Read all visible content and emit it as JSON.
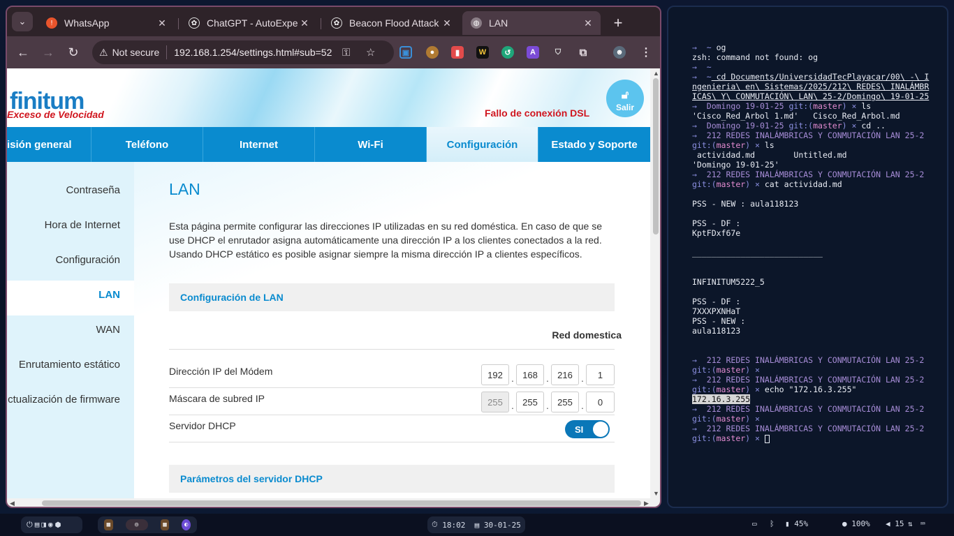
{
  "browser": {
    "tabs": [
      {
        "title": "WhatsApp",
        "icon": "whatsapp-icon",
        "active": false
      },
      {
        "title": "ChatGPT - AutoExpert",
        "icon": "chatgpt-icon",
        "active": false
      },
      {
        "title": "Beacon Flood Attack",
        "icon": "chatgpt-icon",
        "active": false
      },
      {
        "title": "LAN",
        "icon": "globe-icon",
        "active": true
      }
    ],
    "security_label": "Not secure",
    "url": "192.168.1.254/settings.html#sub=52"
  },
  "page": {
    "brand": "finitum",
    "tagline": "Exceso de Velocidad",
    "dsl_status": "Fallo de conexión DSL",
    "logout_label": "Salir",
    "main_tabs": [
      "isión general",
      "Teléfono",
      "Internet",
      "Wi-Fi",
      "Configuración",
      "Estado y Soporte"
    ],
    "active_main_tab": "Configuración",
    "sidebar": [
      "Contraseña",
      "Hora de Internet",
      "Configuración",
      "LAN",
      "WAN",
      "Enrutamiento estático",
      "ctualización de firmware"
    ],
    "active_sidebar": "LAN",
    "title": "LAN",
    "description": "Esta página permite configurar las direcciones IP utilizadas en su red doméstica. En caso de que se use DHCP el enrutador asigna automáticamente una dirección IP a los clientes conectados a la red. Usando DHCP estático es posible asignar siempre la misma dirección IP a clientes específicos.",
    "section_lan": "Configuración de LAN",
    "column_header": "Red domestica",
    "modem_ip_label": "Dirección IP del Módem",
    "modem_ip": [
      "192",
      "168",
      "216",
      "1"
    ],
    "subnet_label": "Máscara de subred IP",
    "subnet": [
      "255",
      "255",
      "255",
      "0"
    ],
    "dhcp_label": "Servidor DHCP",
    "dhcp_toggle": "SI",
    "section_dhcp": "Parámetros del servidor DHCP"
  },
  "terminal": {
    "lines": [
      "→  ~ og",
      "zsh: command not found: og",
      "→  ~",
      "→  ~ cd Documents/UniversidadTecPlayacar/00\\ -\\ Ingenieria\\ en\\ Sistemas/2025/212\\ REDES\\ INALÁMBRICAS\\ Y\\ CONMUTACIÓN\\ LAN\\ 25-2/Domingo\\ 19-01-25",
      "→  Domingo 19-01-25 git:(master) × ls",
      "'Cisco_Red_Arbol 1.md'   Cisco_Red_Arbol.md",
      "→  Domingo 19-01-25 git:(master) × cd ..",
      "→  212 REDES INALÁMBRICAS Y CONMUTACIÓN LAN 25-2 git:(master) × ls",
      " actividad.md        Untitled.md",
      "'Domingo 19-01-25'",
      "→  212 REDES INALÁMBRICAS Y CONMUTACIÓN LAN 25-2 git:(master) × cat actividad.md",
      "",
      "PSS - NEW : aula118123",
      "",
      "PSS - DF :",
      "KptFDxf67e",
      "",
      "___________________________",
      "",
      "",
      "INFINITUM5222_5",
      "",
      "PSS - DF :",
      "7XXXPXNHaT",
      "PSS - NEW :",
      "aula118123",
      "",
      "",
      "→  212 REDES INALÁMBRICAS Y CONMUTACIÓN LAN 25-2 git:(master) ×",
      "→  212 REDES INALÁMBRICAS Y CONMUTACIÓN LAN 25-2 git:(master) × echo \"172.16.3.255\"",
      "172.16.3.255",
      "→  212 REDES INALÁMBRICAS Y CONMUTACIÓN LAN 25-2 git:(master) ×",
      "→  212 REDES INALÁMBRICAS Y CONMUTACIÓN LAN 25-2 git:(master) × "
    ]
  },
  "taskbar": {
    "time": "18:02",
    "date": "30-01-25",
    "battery": "45%",
    "brightness": "100%",
    "volume": "15"
  },
  "colors": {
    "accent": "#0a8bcf",
    "error": "#d0161f",
    "brand": "#1a7dc4"
  }
}
